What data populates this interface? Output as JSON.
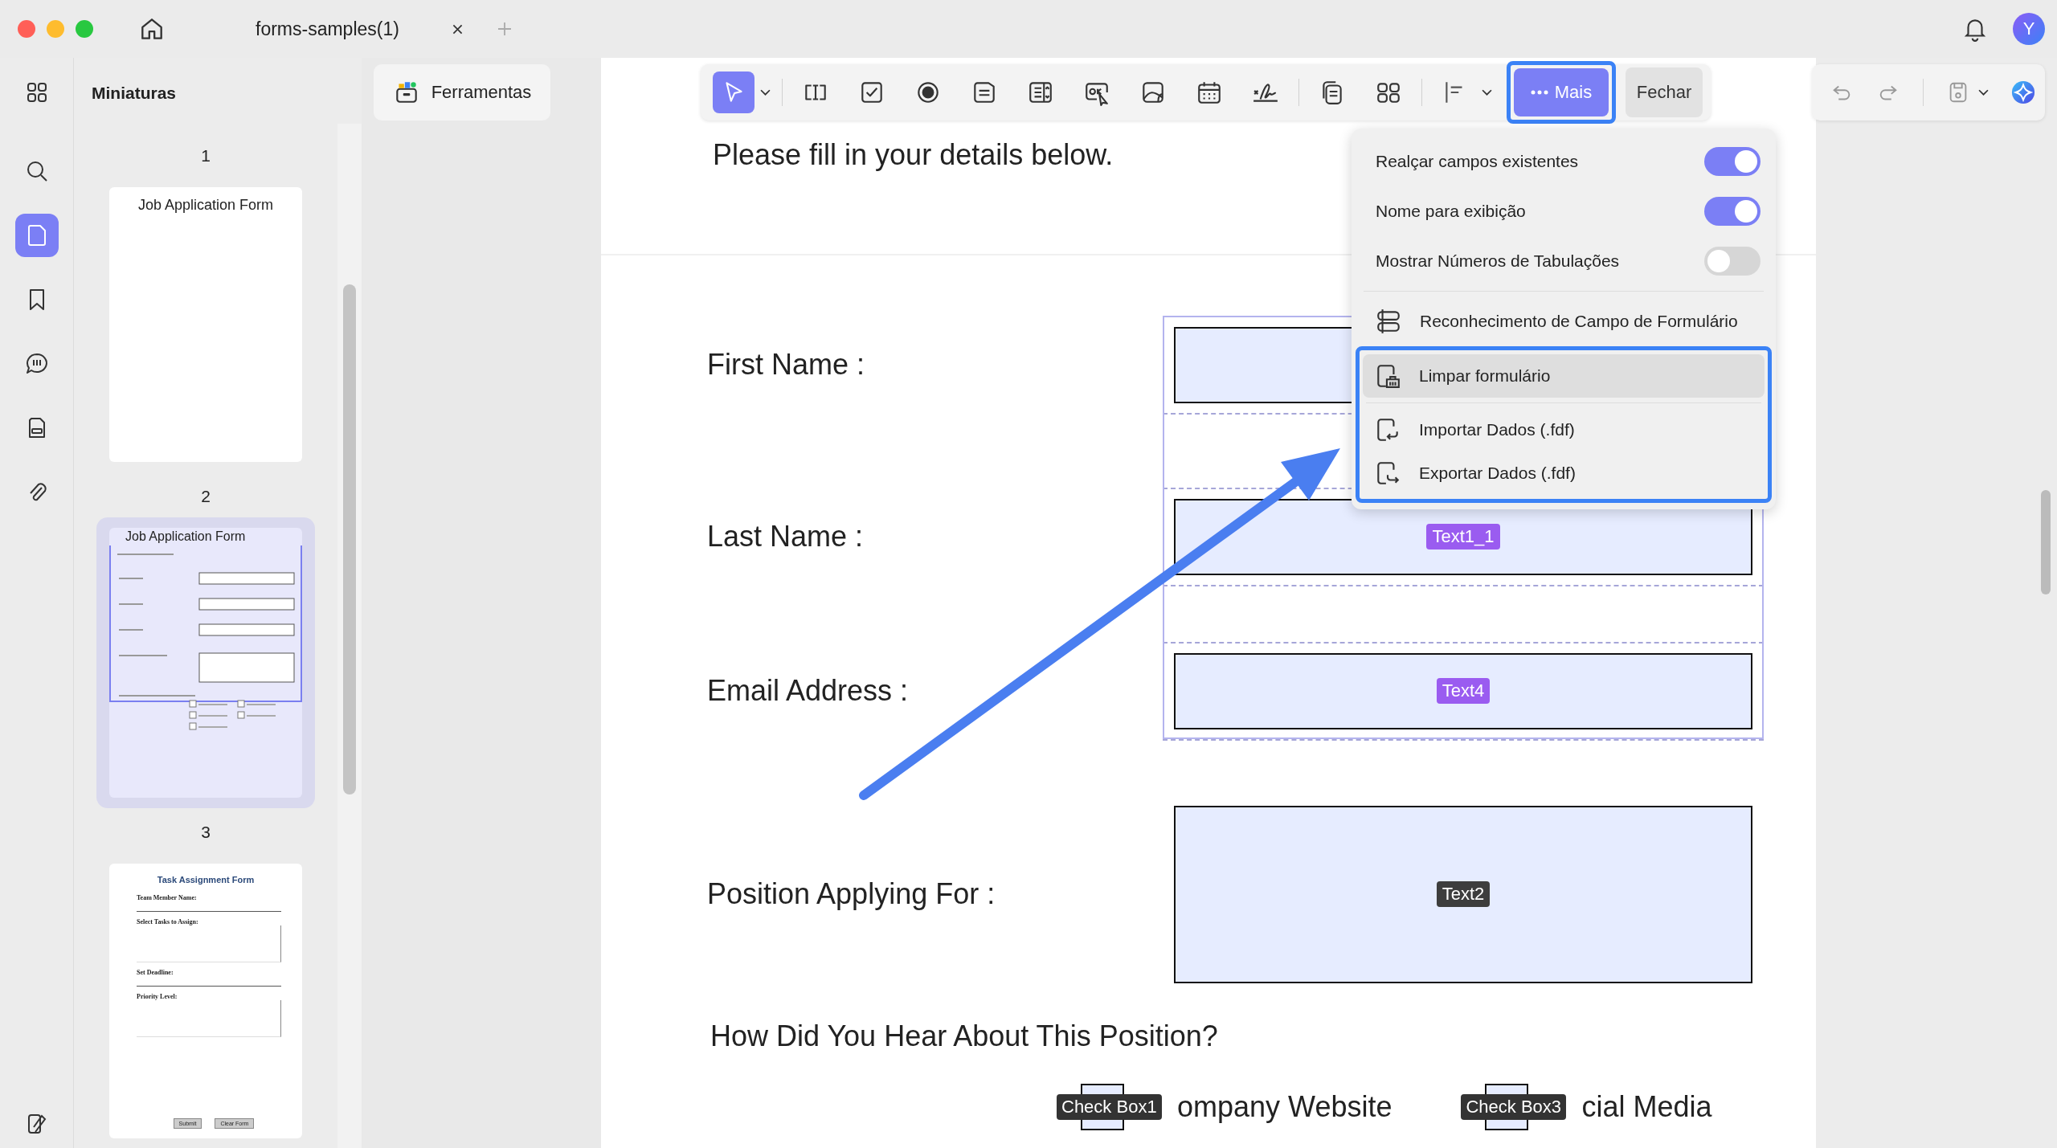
{
  "window": {
    "tab_title": "forms-samples(1)",
    "avatar_initial": "Y"
  },
  "side_rail": [
    {
      "kind": "grid",
      "selected": false
    },
    {
      "kind": "search",
      "selected": false
    },
    {
      "kind": "page",
      "selected": true
    },
    {
      "kind": "bookmark",
      "selected": false
    },
    {
      "kind": "comment",
      "selected": false
    },
    {
      "kind": "stamp",
      "selected": false
    },
    {
      "kind": "attachment",
      "selected": false
    }
  ],
  "thumbnails_panel": {
    "title": "Miniaturas",
    "pages": [
      {
        "number": "1",
        "kind": "title_page",
        "selected": false,
        "texts": [
          "Job Application Form"
        ]
      },
      {
        "number": "2",
        "kind": "form_page",
        "selected": true,
        "texts": [
          "Job Application Form"
        ]
      },
      {
        "number": "3",
        "kind": "task_page",
        "selected": false,
        "texts": [
          "Task Assignment Form",
          "Team Member Name:",
          "Select Tasks to Assign:",
          "Set Deadline:",
          "Priority Level:",
          "Submit",
          "Clear Form"
        ]
      }
    ]
  },
  "tools_button": "Ferramentas",
  "toolbar": {
    "tools": [
      {
        "kind": "pointer",
        "selected": true
      },
      {
        "kind": "text_field",
        "selected": false
      },
      {
        "kind": "checkbox",
        "selected": false
      },
      {
        "kind": "radio",
        "selected": false
      },
      {
        "kind": "list",
        "selected": false
      },
      {
        "kind": "combo",
        "selected": false
      },
      {
        "kind": "button",
        "selected": false
      },
      {
        "kind": "image",
        "selected": false
      },
      {
        "kind": "date",
        "selected": false
      },
      {
        "kind": "signature",
        "selected": false
      },
      {
        "kind": "duplicate",
        "selected": false
      },
      {
        "kind": "grid",
        "selected": false
      },
      {
        "kind": "align",
        "selected": false
      }
    ],
    "more_button": "Mais",
    "close_button": "Fechar"
  },
  "document": {
    "intro": "Please fill in your details below.",
    "fields": [
      {
        "label": "First Name :",
        "kind": "line"
      },
      {
        "label": "Last Name :",
        "kind": "line",
        "tag": {
          "text": "Text1_1",
          "selected": true
        }
      },
      {
        "label": "Email Address :",
        "kind": "line",
        "tag": {
          "text": "Text4",
          "selected": true
        }
      },
      {
        "label": "Position Applying For :",
        "kind": "multiline",
        "tag": {
          "text": "Text2",
          "selected": false
        }
      }
    ],
    "question": "How Did You Hear About This Position?",
    "checkboxes": [
      {
        "tag": "Check Box1",
        "label": "ompany Website",
        "checked": false
      },
      {
        "tag": "Check Box3",
        "label": "cial Media",
        "checked": false
      }
    ]
  },
  "menu": {
    "toggles": [
      {
        "label": "Realçar campos existentes",
        "on": true
      },
      {
        "label": "Nome para exibição",
        "on": true
      },
      {
        "label": "Mostrar Números de Tabulações",
        "on": false
      }
    ],
    "recognition": {
      "label": "Reconhecimento de Campo de Formulário"
    },
    "framed_items": [
      {
        "kind": "clear",
        "label": "Limpar formulário",
        "highlighted": true
      },
      {
        "kind": "import",
        "label": "Importar Dados (.fdf)",
        "highlighted": false
      },
      {
        "kind": "export",
        "label": "Exportar Dados (.fdf)",
        "highlighted": false
      }
    ]
  }
}
